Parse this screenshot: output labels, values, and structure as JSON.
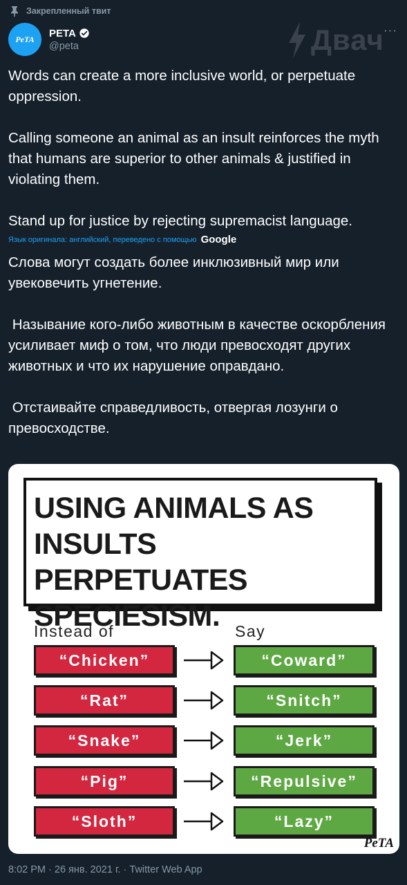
{
  "pinned_label": "Закрепленный твит",
  "author": {
    "display_name": "PETA",
    "handle": "@peta",
    "avatar_text": "PeTA"
  },
  "watermark": "Двач",
  "more_label": "···",
  "tweet": {
    "paragraphs": [
      "Words can create a more inclusive world, or perpetuate oppression.",
      "Calling someone an animal as an insult reinforces the myth that humans are superior to other animals & justified in violating them.",
      "Stand up for justice by rejecting supremacist language."
    ],
    "translation_note": "Язык оригинала: английский, переведено с помощью",
    "translation_provider": "Google",
    "translated_paragraphs": [
      "Слова могут создать более инклюзивный мир или увековечить угнетение.",
      " Называние кого-либо животным в качестве оскорбления усиливает миф о том, что люди превосходят других животных и что их нарушение оправдано.",
      " Отстаивайте справедливость, отвергая лозунги о превосходстве."
    ]
  },
  "image": {
    "title_lines": [
      "USING ANIMALS AS",
      "INSULTS PERPETUATES",
      "SPECIESISM."
    ],
    "left_header": "Instead of",
    "right_header": "Say",
    "rows": [
      {
        "instead": "“Chicken”",
        "say": "“Coward”"
      },
      {
        "instead": "“Rat”",
        "say": "“Snitch”"
      },
      {
        "instead": "“Snake”",
        "say": "“Jerk”"
      },
      {
        "instead": "“Pig”",
        "say": "“Repulsive”"
      },
      {
        "instead": "“Sloth”",
        "say": "“Lazy”"
      }
    ],
    "logo": "PeTA",
    "colors": {
      "red": "#d3263f",
      "green": "#5ea843"
    }
  },
  "footer": "8:02 PM · 26 янв. 2021 г. · Twitter Web App"
}
